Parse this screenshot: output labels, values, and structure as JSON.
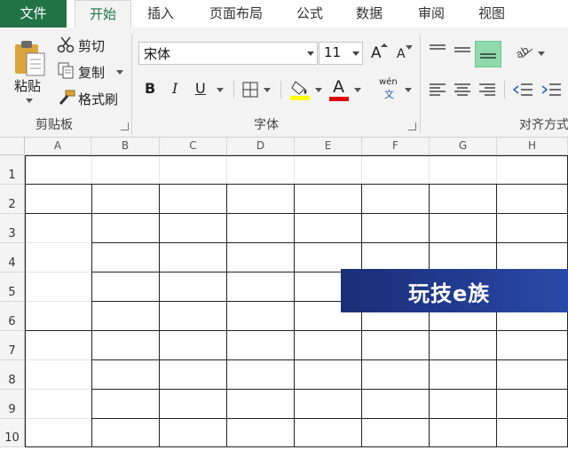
{
  "tabs": [
    "文件",
    "开始",
    "插入",
    "页面布局",
    "公式",
    "数据",
    "审阅",
    "视图"
  ],
  "clipboard": {
    "paste_label": "粘贴",
    "cut_label": "剪切",
    "copy_label": "复制",
    "format_painter_label": "格式刷",
    "group_label": "剪贴板"
  },
  "font": {
    "font_name": "宋体",
    "font_size": "11",
    "bold": "B",
    "italic": "I",
    "underline": "U",
    "increase_size": "A",
    "decrease_size": "A",
    "font_color_letter": "A",
    "phonetic_top": "wén",
    "phonetic_bottom": "文",
    "group_label": "字体"
  },
  "alignment": {
    "group_label": "对齐方式"
  },
  "sheet": {
    "columns": [
      "A",
      "B",
      "C",
      "D",
      "E",
      "F",
      "G",
      "H"
    ],
    "rows": [
      "1",
      "2",
      "3",
      "4",
      "5",
      "6",
      "7",
      "8",
      "9",
      "10"
    ]
  },
  "watermark": {
    "text": "玩技e族"
  },
  "colors": {
    "file_tab": "#217346",
    "highlight": "#ffff00",
    "font_red": "#e00000",
    "banner": "#233d92"
  }
}
